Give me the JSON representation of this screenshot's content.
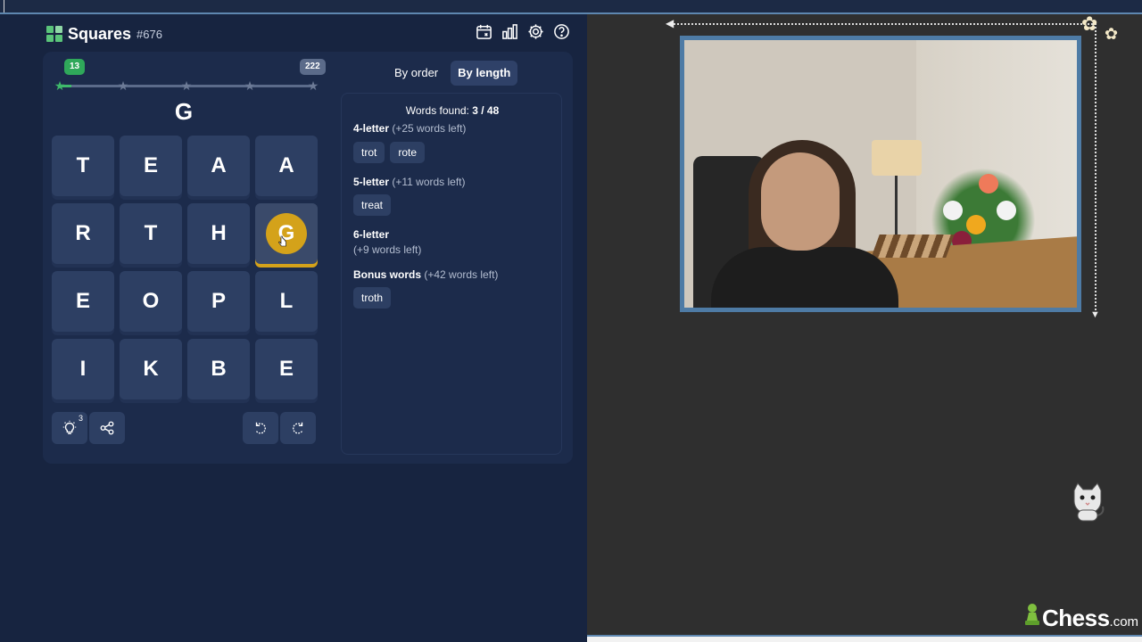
{
  "header": {
    "title": "Squares",
    "game_number": "#676",
    "icons": [
      "calendar-icon",
      "stats-icon",
      "settings-icon",
      "help-icon"
    ]
  },
  "progress": {
    "current_score": "13",
    "max_score": "222",
    "stars": 5,
    "fraction_complete": 0.06
  },
  "current_word": "G",
  "grid": {
    "rows": [
      [
        "T",
        "E",
        "A",
        "A"
      ],
      [
        "R",
        "T",
        "H",
        "G"
      ],
      [
        "E",
        "O",
        "P",
        "L"
      ],
      [
        "I",
        "K",
        "B",
        "E"
      ]
    ],
    "selected": [
      [
        1,
        3
      ]
    ]
  },
  "controls": {
    "hint_count": "3",
    "buttons": [
      "hint-button",
      "share-button",
      "undo-button",
      "redo-button"
    ]
  },
  "tabs": [
    {
      "label": "By order",
      "active": false
    },
    {
      "label": "By length",
      "active": true
    }
  ],
  "words": {
    "found_label": "Words found:",
    "found_value": "3 / 48",
    "sections": [
      {
        "label": "4-letter",
        "remaining": "(+25 words left)",
        "words": [
          "trot",
          "rote"
        ]
      },
      {
        "label": "5-letter",
        "remaining": "(+11 words left)",
        "words": [
          "treat"
        ]
      },
      {
        "label": "6-letter",
        "remaining": "(+9 words left)",
        "words": []
      },
      {
        "label": "Bonus words",
        "remaining": "(+42 words left)",
        "words": [
          "troth"
        ]
      }
    ]
  },
  "colors": {
    "panel_bg": "#172440",
    "tile_bg": "#2d3f63",
    "selected_accent": "#d4a21a",
    "progress_green": "#3fba6b",
    "webcam_border": "#4e7ba5"
  },
  "branding": {
    "name": "Chess",
    "tld": ".com"
  }
}
